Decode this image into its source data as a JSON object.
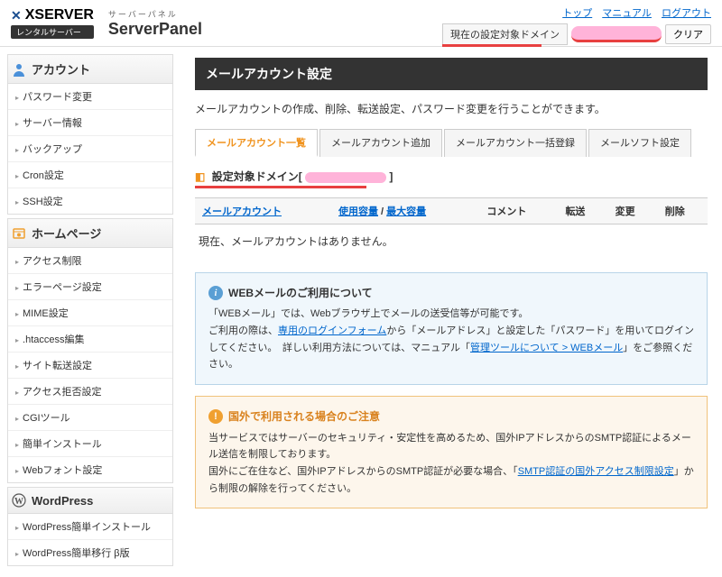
{
  "header": {
    "brand": "XSERVER",
    "brand_sub": "レンタルサーバー",
    "panel_jp": "サーバーパネル",
    "panel_en": "ServerPanel",
    "links": {
      "top": "トップ",
      "manual": "マニュアル",
      "logout": "ログアウト"
    },
    "domain_label": "現在の設定対象ドメイン",
    "clear": "クリア"
  },
  "sidebar": {
    "sections": [
      {
        "title": "アカウント",
        "icon": "account",
        "items": [
          "パスワード変更",
          "サーバー情報",
          "バックアップ",
          "Cron設定",
          "SSH設定"
        ]
      },
      {
        "title": "ホームページ",
        "icon": "homepage",
        "items": [
          "アクセス制限",
          "エラーページ設定",
          "MIME設定",
          ".htaccess編集",
          "サイト転送設定",
          "アクセス拒否設定",
          "CGIツール",
          "簡単インストール",
          "Webフォント設定"
        ]
      },
      {
        "title": "WordPress",
        "icon": "wordpress",
        "items": [
          "WordPress簡単インストール",
          "WordPress簡単移行 β版"
        ]
      }
    ]
  },
  "main": {
    "title": "メールアカウント設定",
    "desc": "メールアカウントの作成、削除、転送設定、パスワード変更を行うことができます。",
    "tabs": [
      "メールアカウント一覧",
      "メールアカウント追加",
      "メールアカウント一括登録",
      "メールソフト設定"
    ],
    "target_label": "設定対象ドメイン",
    "table": {
      "cols": [
        "メールアカウント",
        "使用容量",
        "最大容量",
        "コメント",
        "転送",
        "変更",
        "削除"
      ],
      "sep": " / "
    },
    "empty": "現在、メールアカウントはありません。",
    "info": {
      "title": "WEBメールのご利用について",
      "line1": "「WEBメール」では、Webブラウザ上でメールの送受信等が可能です。",
      "line2a": "ご利用の際は、",
      "link1": "専用のログインフォーム",
      "line2b": "から「メールアドレス」と設定した「パスワード」を用いてログインしてください。　詳しい利用方法については、マニュアル「",
      "link2": "管理ツールについて > WEBメール",
      "line2c": "」をご参照ください。"
    },
    "warn": {
      "title": "国外で利用される場合のご注意",
      "line1": "当サービスではサーバーのセキュリティ・安定性を高めるため、国外IPアドレスからのSMTP認証によるメール送信を制限しております。",
      "line2a": "国外にご在住など、国外IPアドレスからのSMTP認証が必要な場合、「",
      "link": "SMTP認証の国外アクセス制限設定",
      "line2b": "」から制限の解除を行ってください。"
    }
  }
}
